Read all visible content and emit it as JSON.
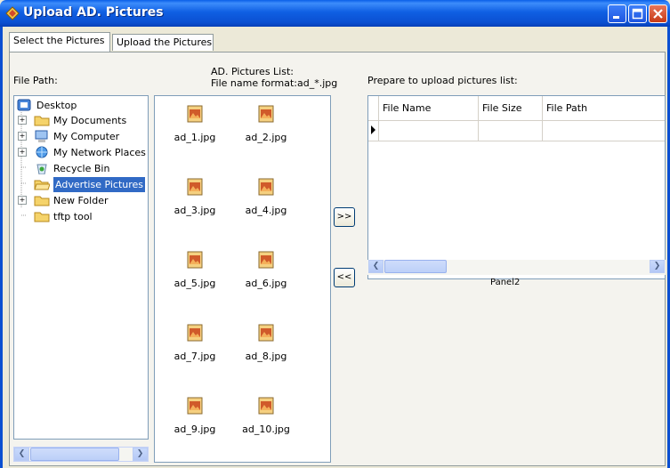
{
  "window": {
    "title": "Upload AD. Pictures"
  },
  "tabs": [
    {
      "label": "Select the Pictures",
      "active": true
    },
    {
      "label": "Upload the Pictures",
      "active": false
    }
  ],
  "left_panel": {
    "file_path_label": "File Path:",
    "tree": [
      {
        "label": "Desktop",
        "icon": "desktop-icon",
        "expander": ""
      },
      {
        "label": "My Documents",
        "icon": "folder-icon",
        "expander": "+"
      },
      {
        "label": "My Computer",
        "icon": "computer-icon",
        "expander": "+"
      },
      {
        "label": "My Network Places",
        "icon": "network-icon",
        "expander": "+"
      },
      {
        "label": "Recycle Bin",
        "icon": "recycle-bin-icon",
        "expander": ""
      },
      {
        "label": "Advertise Pictures",
        "icon": "folder-open-icon",
        "expander": "",
        "selected": true
      },
      {
        "label": "New Folder",
        "icon": "folder-icon",
        "expander": "+"
      },
      {
        "label": "tftp tool",
        "icon": "folder-icon",
        "expander": ""
      }
    ]
  },
  "pictures_list": {
    "title_line1": "AD. Pictures List:",
    "title_line2": "File name format:ad_*.jpg",
    "files": [
      "ad_1.jpg",
      "ad_2.jpg",
      "ad_3.jpg",
      "ad_4.jpg",
      "ad_5.jpg",
      "ad_6.jpg",
      "ad_7.jpg",
      "ad_8.jpg",
      "ad_9.jpg",
      "ad_10.jpg"
    ]
  },
  "buttons": {
    "add": ">>",
    "remove": "<<"
  },
  "upload_list": {
    "title": "Prepare to upload pictures list:",
    "columns": [
      "File Name",
      "File Size",
      "File Path"
    ],
    "panel_label": "Panel2"
  },
  "colors": {
    "titlebar": "#0b4fd1",
    "selection": "#316ac5"
  }
}
